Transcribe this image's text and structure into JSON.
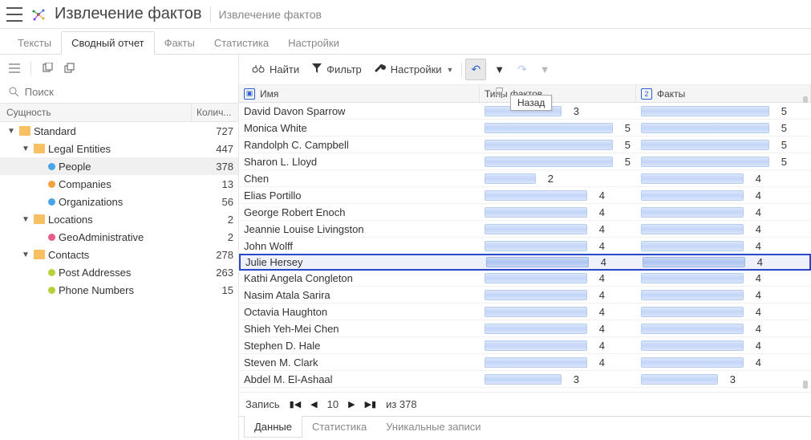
{
  "header": {
    "title": "Извлечение фактов",
    "subtitle": "Извлечение фактов"
  },
  "tabs_top": [
    {
      "label": "Тексты",
      "active": false
    },
    {
      "label": "Сводный отчет",
      "active": true
    },
    {
      "label": "Факты",
      "active": false
    },
    {
      "label": "Статистика",
      "active": false
    },
    {
      "label": "Настройки",
      "active": false
    }
  ],
  "left": {
    "search_placeholder": "Поиск",
    "col_entity": "Сущность",
    "col_count": "Колич...",
    "tree": [
      {
        "indent": 0,
        "expand": "▼",
        "icon": "folder",
        "label": "Standard",
        "count": 727
      },
      {
        "indent": 1,
        "expand": "▼",
        "icon": "folder",
        "label": "Legal Entities",
        "count": 447
      },
      {
        "indent": 2,
        "expand": "",
        "icon": "dot",
        "color": "#4aa4e8",
        "label": "People",
        "count": 378,
        "selected": true
      },
      {
        "indent": 2,
        "expand": "",
        "icon": "dot",
        "color": "#f2a13e",
        "label": "Companies",
        "count": 13
      },
      {
        "indent": 2,
        "expand": "",
        "icon": "dot",
        "color": "#4aa4e8",
        "label": "Organizations",
        "count": 56
      },
      {
        "indent": 1,
        "expand": "▼",
        "icon": "folder",
        "label": "Locations",
        "count": 2
      },
      {
        "indent": 2,
        "expand": "",
        "icon": "dot",
        "color": "#e85a8c",
        "label": "GeoAdministrative",
        "count": 2
      },
      {
        "indent": 1,
        "expand": "▼",
        "icon": "folder",
        "label": "Contacts",
        "count": 278
      },
      {
        "indent": 2,
        "expand": "",
        "icon": "dot",
        "color": "#b6cf3a",
        "label": "Post Addresses",
        "count": 263
      },
      {
        "indent": 2,
        "expand": "",
        "icon": "dot",
        "color": "#b6cf3a",
        "label": "Phone Numbers",
        "count": 15
      }
    ]
  },
  "toolbar": {
    "find": "Найти",
    "filter": "Фильтр",
    "settings": "Настройки",
    "tooltip": "Назад"
  },
  "grid": {
    "col_name": "Имя",
    "col_types": "Типы фактов",
    "col_facts": "Факты",
    "col_facts_badge": "2",
    "max_types": 5,
    "max_facts": 5,
    "rows": [
      {
        "name": "David Davon Sparrow",
        "types": 3,
        "facts": 5,
        "selected": false
      },
      {
        "name": "Monica White",
        "types": 5,
        "facts": 5,
        "selected": false
      },
      {
        "name": "Randolph C. Campbell",
        "types": 5,
        "facts": 5,
        "selected": false
      },
      {
        "name": "Sharon L. Lloyd",
        "types": 5,
        "facts": 5,
        "selected": false
      },
      {
        "name": "Chen",
        "types": 2,
        "facts": 4,
        "selected": false
      },
      {
        "name": "Elias Portillo",
        "types": 4,
        "facts": 4,
        "selected": false
      },
      {
        "name": "George Robert Enoch",
        "types": 4,
        "facts": 4,
        "selected": false
      },
      {
        "name": "Jeannie Louise Livingston",
        "types": 4,
        "facts": 4,
        "selected": false
      },
      {
        "name": "John Wolff",
        "types": 4,
        "facts": 4,
        "selected": false
      },
      {
        "name": "Julie Hersey",
        "types": 4,
        "facts": 4,
        "selected": true
      },
      {
        "name": "Kathi Angela Congleton",
        "types": 4,
        "facts": 4,
        "selected": false
      },
      {
        "name": "Nasim Atala Sarira",
        "types": 4,
        "facts": 4,
        "selected": false
      },
      {
        "name": "Octavia Haughton",
        "types": 4,
        "facts": 4,
        "selected": false
      },
      {
        "name": "Shieh Yeh-Mei Chen",
        "types": 4,
        "facts": 4,
        "selected": false
      },
      {
        "name": "Stephen D. Hale",
        "types": 4,
        "facts": 4,
        "selected": false
      },
      {
        "name": "Steven M. Clark",
        "types": 4,
        "facts": 4,
        "selected": false
      },
      {
        "name": "Abdel M. El-Ashaal",
        "types": 3,
        "facts": 3,
        "selected": false
      }
    ]
  },
  "pager": {
    "record_label": "Запись",
    "current": "10",
    "of_label": "из 378"
  },
  "tabs_bottom": [
    {
      "label": "Данные",
      "active": true
    },
    {
      "label": "Статистика",
      "active": false
    },
    {
      "label": "Уникальные записи",
      "active": false
    }
  ]
}
